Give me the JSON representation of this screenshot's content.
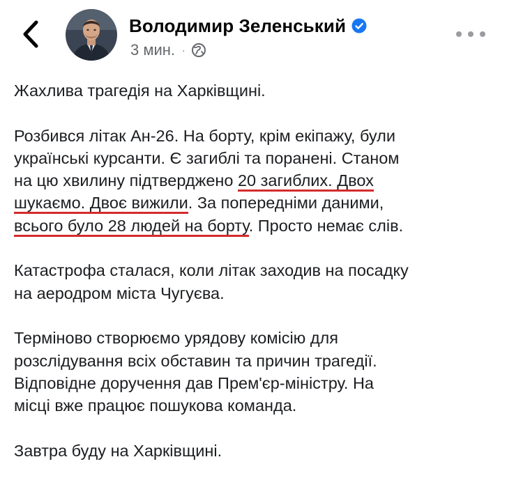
{
  "header": {
    "author_name": "Володимир Зеленський",
    "post_time": "3 мин.",
    "meta_separator": "·",
    "icons": {
      "back": "chevron-left-icon",
      "verified": "verified-badge-icon",
      "audience": "globe-icon",
      "more": "more-horizontal-icon"
    },
    "colors": {
      "verified_blue": "#1877f2",
      "meta_gray": "#65676b",
      "underline_red": "#d42b2b"
    }
  },
  "post": {
    "p1": {
      "l1": "Жахлива трагедія на Харківщині."
    },
    "p2": {
      "l1": "Розбився літак Ан-26. На борту, крім екіпажу, були",
      "l2": "українські курсанти. Є загиблі та поранені. Станом",
      "l3a": "на цю хвилину підтверджено ",
      "l3u": "20 загиблих. Двох",
      "l4u": "шукаємо. Двоє вижили",
      "l4b": ". За попередніми даними,",
      "l5u": "всього було 28 людей на борту",
      "l5b": ". Просто немає слів."
    },
    "p3": {
      "l1": "Катастрофа сталася, коли літак заходив на посадку",
      "l2": "на аеродром міста Чугуєва."
    },
    "p4": {
      "l1": "Терміново створюємо урядову комісію для",
      "l2": "розслідування всіх обставин та причин трагедії.",
      "l3": "Відповідне доручення дав Прем'єр-міністру. На",
      "l4": "місці вже працює пошукова команда."
    },
    "p5": {
      "l1": "Завтра буду на Харківщині."
    }
  }
}
